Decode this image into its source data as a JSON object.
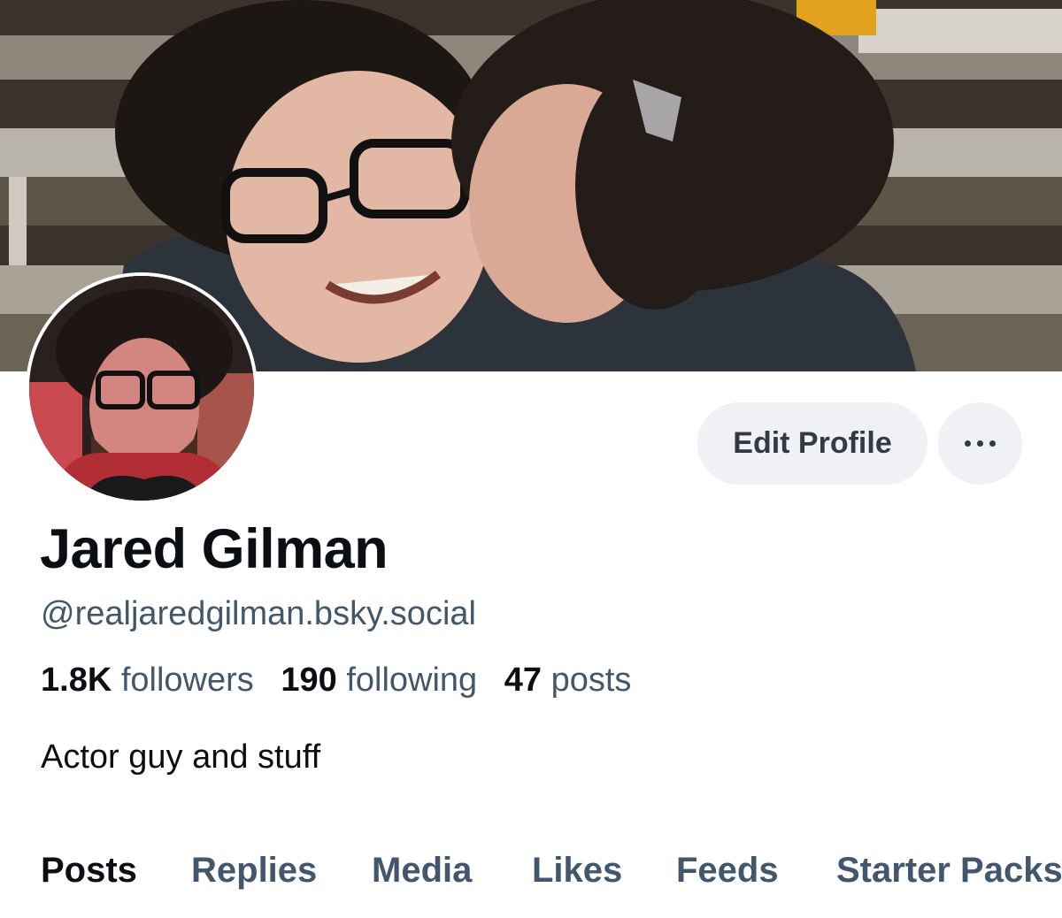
{
  "profile": {
    "display_name": "Jared Gilman",
    "handle": "@realjaredgilman.bsky.social",
    "bio": "Actor guy and stuff",
    "stats": {
      "followers_count": "1.8K",
      "followers_label": "followers",
      "following_count": "190",
      "following_label": "following",
      "posts_count": "47",
      "posts_label": "posts"
    }
  },
  "actions": {
    "edit_profile_label": "Edit Profile",
    "more_icon": "ellipsis-icon"
  },
  "tabs": [
    {
      "label": "Posts",
      "active": true
    },
    {
      "label": "Replies",
      "active": false
    },
    {
      "label": "Media",
      "active": false
    },
    {
      "label": "Likes",
      "active": false
    },
    {
      "label": "Feeds",
      "active": false
    },
    {
      "label": "Starter Packs",
      "active": false
    }
  ],
  "colors": {
    "primary_text": "#0b0f14",
    "secondary_text": "#42576c",
    "button_bg": "#eff1f4",
    "button_text": "#333a45"
  }
}
